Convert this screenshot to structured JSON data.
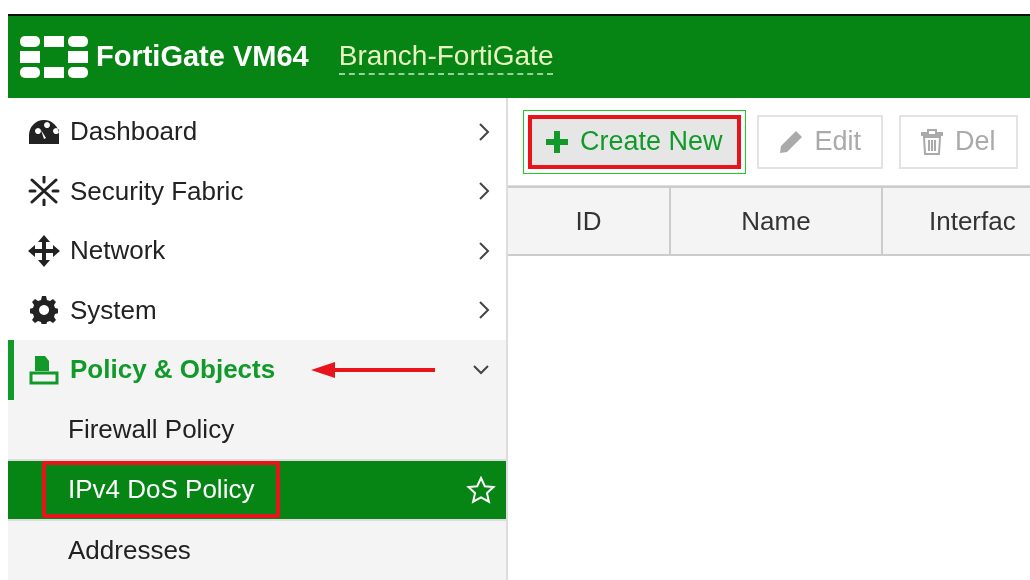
{
  "header": {
    "product": "FortiGate VM64",
    "hostname": "Branch-FortiGate"
  },
  "sidebar": {
    "items": [
      {
        "label": "Dashboard",
        "expanded": false,
        "selected": false,
        "arrow": false
      },
      {
        "label": "Security Fabric",
        "expanded": false,
        "selected": false,
        "arrow": false
      },
      {
        "label": "Network",
        "expanded": false,
        "selected": false,
        "arrow": false
      },
      {
        "label": "System",
        "expanded": false,
        "selected": false,
        "arrow": false
      },
      {
        "label": "Policy & Objects",
        "expanded": true,
        "selected": true,
        "arrow": true,
        "children": [
          {
            "label": "Firewall Policy",
            "selected": false,
            "highlighted": false
          },
          {
            "label": "IPv4 DoS Policy",
            "selected": true,
            "highlighted": true
          },
          {
            "label": "Addresses",
            "selected": false,
            "highlighted": false
          }
        ]
      }
    ]
  },
  "toolbar": {
    "buttons": [
      {
        "label": "Create New",
        "highlighted": true
      },
      {
        "label": "Edit",
        "highlighted": false
      },
      {
        "label": "Del",
        "highlighted": false
      }
    ]
  },
  "table": {
    "columns": [
      "ID",
      "Name",
      "Interfac"
    ]
  }
}
